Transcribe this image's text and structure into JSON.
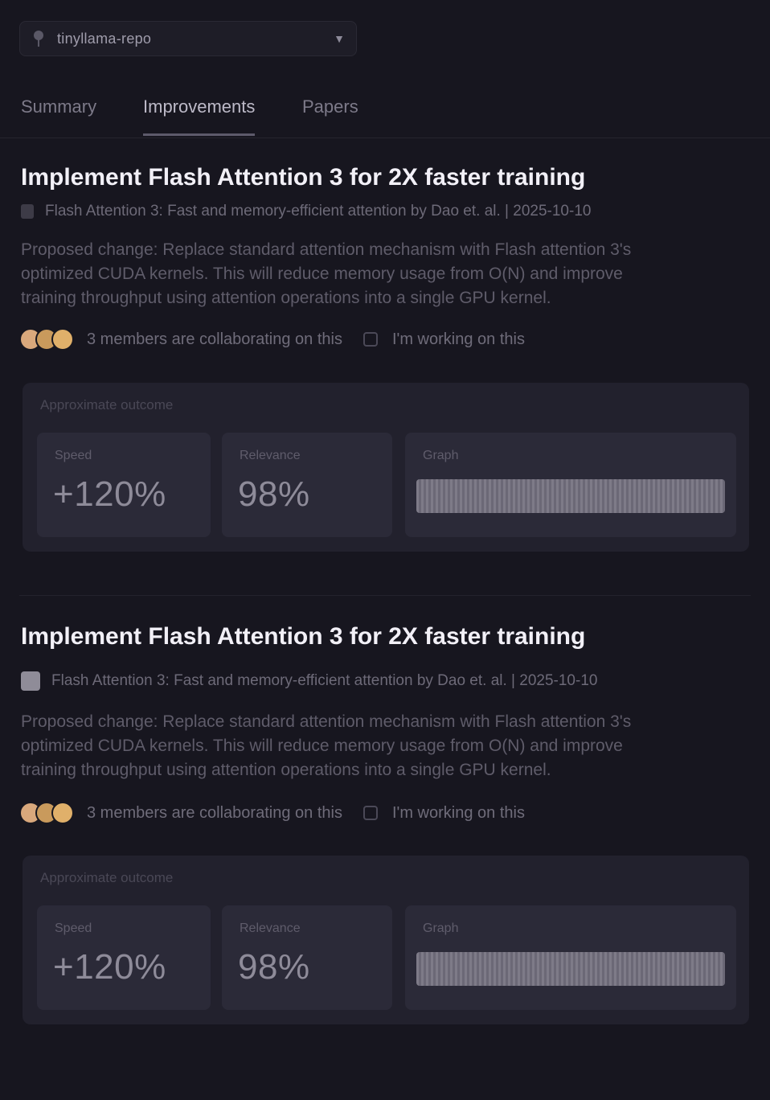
{
  "repo_selector": {
    "name": "tinyllama-repo",
    "icon": "pin-icon"
  },
  "tabs": [
    {
      "label": "Summary",
      "active": false
    },
    {
      "label": "Improvements",
      "active": true
    },
    {
      "label": "Papers",
      "active": false
    }
  ],
  "improvements": [
    {
      "title": "Implement Flash Attention 3 for 2X faster training",
      "paper": "Flash Attention 3: Fast and memory-efficient attention by Dao et. al. | 2025-10-10",
      "description": "Proposed change: Replace standard attention mechanism with Flash attention 3's optimized CUDA kernels. This will reduce memory usage from O(N) and improve training throughput using attention operations into a single GPU kernel.",
      "collab_text": "3 members are collaborating on this",
      "working_label": "I'm working on this",
      "panel_title": "Approximate outcome",
      "metrics": {
        "speed_label": "Speed",
        "speed_value": "+120%",
        "relevance_label": "Relevance",
        "relevance_value": "98%",
        "graph_label": "Graph"
      }
    },
    {
      "title": "Implement Flash Attention 3 for 2X faster training",
      "paper": "Flash Attention 3: Fast and memory-efficient attention by Dao et. al. | 2025-10-10",
      "description": "Proposed change: Replace standard attention mechanism with Flash attention 3's optimized CUDA kernels. This will reduce memory usage from O(N) and improve training throughput using attention operations into a single GPU kernel.",
      "collab_text": "3 members are collaborating on this",
      "working_label": "I'm working on this",
      "panel_title": "Approximate outcome",
      "metrics": {
        "speed_label": "Speed",
        "speed_value": "+120%",
        "relevance_label": "Relevance",
        "relevance_value": "98%",
        "graph_label": "Graph"
      }
    }
  ],
  "colors": {
    "background": "#17161f",
    "panel": "#22212d",
    "metric_tile": "#2b2a38",
    "avatar_colors": [
      "#d9a87c",
      "#c99a5c",
      "#e0b06a"
    ]
  }
}
